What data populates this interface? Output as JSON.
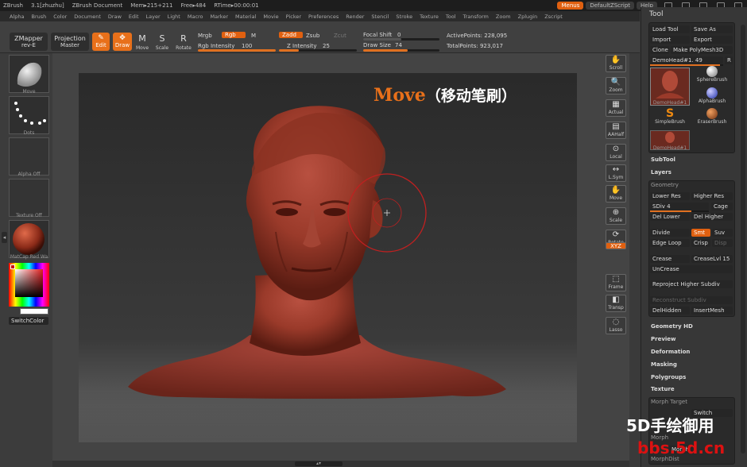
{
  "titlebar": {
    "app": "ZBrush",
    "version": "3.1[zhuzhu]",
    "document": "ZBrush Document",
    "mem": "Mem▸215+211",
    "free": "Free▸484",
    "rtime": "RTime▸00:00:01",
    "menus_btn": "Menus",
    "script_btn": "DefaultZScript",
    "help_btn": "Help"
  },
  "menubar": [
    "Alpha",
    "Brush",
    "Color",
    "Document",
    "Draw",
    "Edit",
    "Layer",
    "Light",
    "Macro",
    "Marker",
    "Material",
    "Movie",
    "Picker",
    "Preferences",
    "Render",
    "Stencil",
    "Stroke",
    "Texture",
    "Tool",
    "Transform",
    "Zoom",
    "Zplugin",
    "Zscript"
  ],
  "toolbar": {
    "zmapper": "ZMapper",
    "zmapper_sub": "rev-E",
    "projection": "Projection",
    "projection_sub": "Master",
    "edit": "Edit",
    "draw": "Draw",
    "move": "Move",
    "scale": "Scale",
    "rotate": "Rotate",
    "mrgb": "Mrgb",
    "rgb": "Rgb",
    "m": "M",
    "rgb_intensity_label": "Rgb Intensity",
    "rgb_intensity": "100",
    "zadd": "Zadd",
    "zsub": "Zsub",
    "zcut": "Zcut",
    "z_intensity_label": "Z Intensity",
    "z_intensity": "25",
    "z_intensity_value": 0.25,
    "focal_shift_label": "Focal Shift",
    "focal_shift": "0",
    "draw_size_label": "Draw Size",
    "draw_size": "74",
    "draw_size_value": 0.58,
    "active_points": "ActivePoints: 228,095",
    "total_points": "TotalPoints: 923,017"
  },
  "leftshelf": {
    "move": "Move",
    "dots": "Dots",
    "alpha": "Alpha Off",
    "texture": "Texture Off",
    "matcap": "MatCap Red Wa",
    "switchcolor": "SwitchColor"
  },
  "rightshelf": [
    "Scroll",
    "Zoom",
    "Actual",
    "AAHalf",
    "Local",
    "L.Sym",
    "Move",
    "Scale",
    "Rotate",
    "XYZ",
    "Frame",
    "Transp",
    "Lasso"
  ],
  "tool_panel": {
    "title": "Tool",
    "load_tool": "Load Tool",
    "save_as": "Save As",
    "import": "Import",
    "export": "Export",
    "clone": "Clone",
    "make_polymesh": "Make PolyMesh3D",
    "current_tool": "DemoHead#1.",
    "current_tool_value": "49",
    "r": "R",
    "brushes": [
      "DemoHead#1",
      "SphereBrush",
      "AlphaBrush",
      "SimpleBrush",
      "EraserBrush",
      "DemoHead#1"
    ],
    "subtool": "SubTool",
    "layers": "Layers",
    "geometry": "Geometry",
    "lower_res": "Lower Res",
    "higher_res": "Higher Res",
    "sdiv": "SDiv 4",
    "cage": "Cage",
    "del_lower": "Del Lower",
    "del_higher": "Del Higher",
    "divide": "Divide",
    "smt": "Smt",
    "suv": "Suv",
    "edge_loop": "Edge Loop",
    "crisp": "Crisp",
    "disp": "Disp",
    "crease": "Crease",
    "crease_lvl": "CreaseLvl 15",
    "uncrease": "UnCrease",
    "reproject": "Reproject Higher Subdiv",
    "reconstruct": "Reconstruct Subdiv",
    "delhidden": "DelHidden",
    "insertmesh": "InsertMesh",
    "geometry_hd": "Geometry HD",
    "preview": "Preview",
    "deformation": "Deformation",
    "masking": "Masking",
    "polygroups": "Polygroups",
    "texture": "Texture",
    "morph_target": "Morph Target",
    "switch": "Switch",
    "morph": "Morph",
    "morph_btn": "Morph",
    "morph_dist": "MorphDist"
  },
  "overlay": {
    "title": "Move",
    "subtitle": "（移动笔刷）"
  },
  "watermark": {
    "line1": "5D手绘御用",
    "line2": "bbs.5d.cn"
  },
  "colors": {
    "accent": "#e06010",
    "skin": "#a0402e",
    "bg": "#3a3a3a"
  }
}
